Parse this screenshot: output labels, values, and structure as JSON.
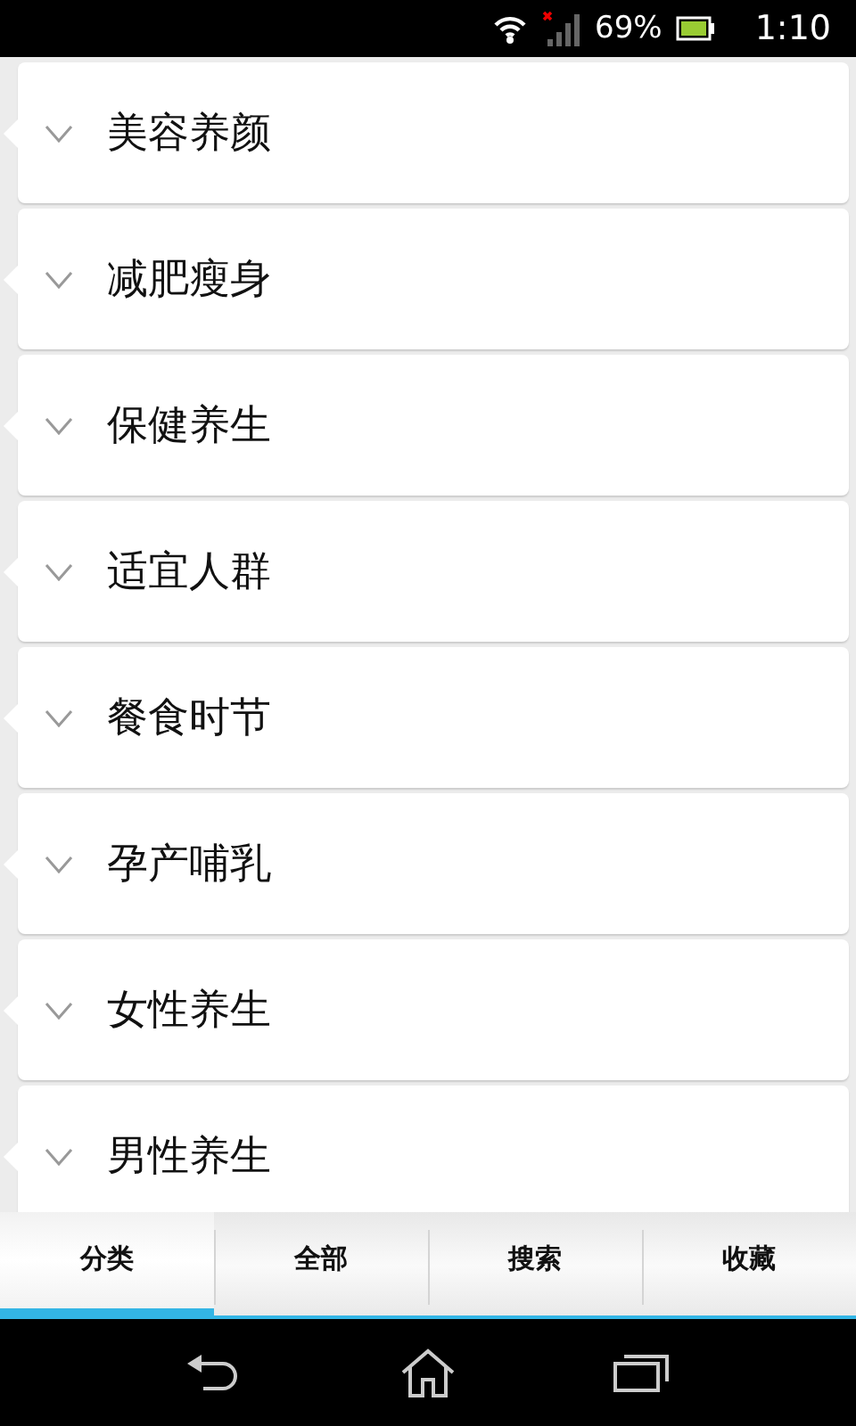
{
  "status_bar": {
    "battery_text": "69%",
    "time": "1:10"
  },
  "categories": [
    {
      "label": "美容养颜",
      "expanded": false
    },
    {
      "label": "减肥瘦身",
      "expanded": false
    },
    {
      "label": "保健养生",
      "expanded": false
    },
    {
      "label": "适宜人群",
      "expanded": false
    },
    {
      "label": "餐食时节",
      "expanded": false
    },
    {
      "label": "孕产哺乳",
      "expanded": false
    },
    {
      "label": "女性养生",
      "expanded": false
    },
    {
      "label": "男性养生",
      "expanded": false
    }
  ],
  "tabs": [
    {
      "label": "分类",
      "selected": true
    },
    {
      "label": "全部",
      "selected": false
    },
    {
      "label": "搜索",
      "selected": false
    },
    {
      "label": "收藏",
      "selected": false
    }
  ]
}
